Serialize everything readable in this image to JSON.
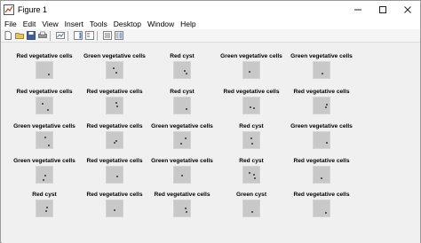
{
  "window": {
    "title": "Figure 1"
  },
  "menu": [
    "File",
    "Edit",
    "View",
    "Insert",
    "Tools",
    "Desktop",
    "Window",
    "Help"
  ],
  "toolbar": [
    "new-figure-icon",
    "open-icon",
    "save-icon",
    "print-icon",
    "link-plot-icon",
    "insert-colorbar-icon",
    "insert-legend-icon",
    "hide-plot-tools-icon",
    "show-plot-tools-icon"
  ],
  "grid": [
    [
      "Red vegetative cells",
      "Green vegetative cells",
      "Red cyst",
      "Green vegetative cells",
      "Green vegetative cells"
    ],
    [
      "Red vegetative cells",
      "Red vegetative cells",
      "Red cyst",
      "Red vegetative cells",
      "Red vegetative cells"
    ],
    [
      "Green vegetative cells",
      "Red vegetative cells",
      "Green vegetative cells",
      "Red cyst",
      "Green vegetative cells"
    ],
    [
      "Green vegetative cells",
      "Red vegetative cells",
      "Green vegetative cells",
      "Red cyst",
      "Red vegetative cells"
    ],
    [
      "Red cyst",
      "Red vegetative cells",
      "Red vegetative cells",
      "Green cyst",
      "Red vegetative cells"
    ]
  ]
}
